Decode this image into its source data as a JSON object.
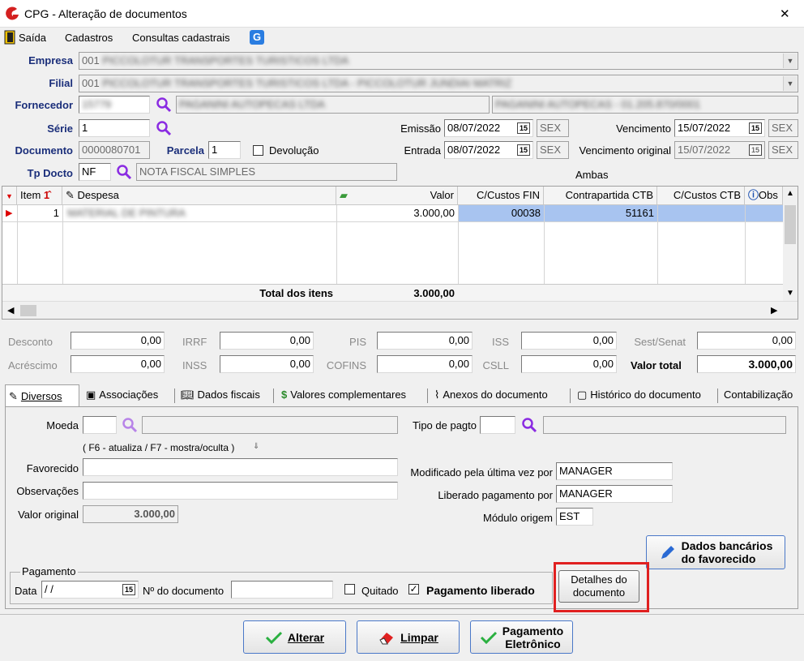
{
  "window": {
    "title": "CPG - Alteração de documentos",
    "close": "✕"
  },
  "menu": {
    "saida": "Saída",
    "cadastros": "Cadastros",
    "consultas": "Consultas cadastrais"
  },
  "header": {
    "empresa_label": "Empresa",
    "empresa_code": "001",
    "empresa_name": "PICCOLOTUR TRANSPORTES TURISTICOS LTDA",
    "filial_label": "Filial",
    "filial_code": "001",
    "filial_name": "PICCOLOTUR TRANSPORTES TURISTICOS LTDA - PICCOLOTUR JUNDIAI MATRIZ",
    "fornecedor_label": "Fornecedor",
    "fornecedor_code": "15779",
    "fornecedor_name": "PAGANINI AUTOPECAS LTDA",
    "fornecedor_fantasia": "PAGANINI AUTOPECAS - 01.205.870/0001",
    "serie_label": "Série",
    "serie_value": "1",
    "documento_label": "Documento",
    "documento_value": "0000080701",
    "parcela_label": "Parcela",
    "parcela_value": "1",
    "devolucao_label": "Devolução",
    "tpdocto_label": "Tp Docto",
    "tpdocto_code": "NF",
    "tpdocto_name": "NOTA FISCAL SIMPLES",
    "emissao_label": "Emissão",
    "emissao_value": "08/07/2022",
    "emissao_day": "SEX",
    "entrada_label": "Entrada",
    "entrada_value": "08/07/2022",
    "entrada_day": "SEX",
    "vencimento_label": "Vencimento",
    "vencimento_value": "15/07/2022",
    "vencimento_day": "SEX",
    "vencorig_label": "Vencimento original",
    "vencorig_value": "15/07/2022",
    "vencorig_day": "SEX",
    "ambas": "Ambas",
    "cal_icon_text": "15"
  },
  "grid": {
    "columns": {
      "item": "Item",
      "despesa": "Despesa",
      "valor": "Valor",
      "ccfin": "C/Custos FIN",
      "contrapartida": "Contrapartida CTB",
      "ccctb": "C/Custos CTB",
      "obs": "Obs"
    },
    "rows": [
      {
        "item": "1",
        "despesa": "MATERIAL DE PINTURA",
        "valor": "3.000,00",
        "ccfin": "00038",
        "contrapartida": "51161",
        "ccctb": ""
      }
    ],
    "total_label": "Total dos itens",
    "total_value": "3.000,00"
  },
  "totals": {
    "desconto_label": "Desconto",
    "desconto": "0,00",
    "irrf_label": "IRRF",
    "irrf": "0,00",
    "pis_label": "PIS",
    "pis": "0,00",
    "iss_label": "ISS",
    "iss": "0,00",
    "sest_label": "Sest/Senat",
    "sest": "0,00",
    "acrescimo_label": "Acréscimo",
    "acrescimo": "0,00",
    "inss_label": "INSS",
    "inss": "0,00",
    "cofins_label": "COFINS",
    "cofins": "0,00",
    "csll_label": "CSLL",
    "csll": "0,00",
    "valor_total_label": "Valor total",
    "valor_total": "3.000,00"
  },
  "tabs": [
    "Diversos",
    "Associações",
    "Dados fiscais",
    "Valores complementares",
    "Anexos do documento",
    "Histórico do documento",
    "Contabilização"
  ],
  "diversos": {
    "moeda_label": "Moeda",
    "moeda_value": "",
    "tipo_pagto_label": "Tipo de pagto",
    "tipo_pagto_value": "",
    "hint": "( F6 - atualiza / F7 - mostra/oculta )",
    "favorecido_label": "Favorecido",
    "favorecido_value": "",
    "observacoes_label": "Observações",
    "observacoes_value": "",
    "valor_original_label": "Valor original",
    "valor_original_value": "3.000,00",
    "modificado_label": "Modificado pela última vez por",
    "modificado_value": "MANAGER",
    "liberado_label": "Liberado pagamento por",
    "liberado_value": "MANAGER",
    "modulo_label": "Módulo origem",
    "modulo_value": "EST",
    "dados_bancarios_line1": "Dados bancários",
    "dados_bancarios_line2": "do favorecido",
    "pagamento_group": "Pagamento",
    "data_label": "Data",
    "data_value": " /  /",
    "ndoc_label": "Nº do documento",
    "ndoc_value": "",
    "quitado_label": "Quitado",
    "pag_liberado_label": "Pagamento liberado",
    "detalhes_line1": "Detalhes do",
    "detalhes_line2": "documento"
  },
  "buttons": {
    "alterar": "Alterar",
    "limpar": "Limpar",
    "pag_line1": "Pagamento",
    "pag_line2": "Eletrônico"
  },
  "colors": {
    "label_blue": "#1a2e7a",
    "highlight_red": "#e02020",
    "selection": "#a8c4f0",
    "magnifier": "#8a2be2"
  }
}
